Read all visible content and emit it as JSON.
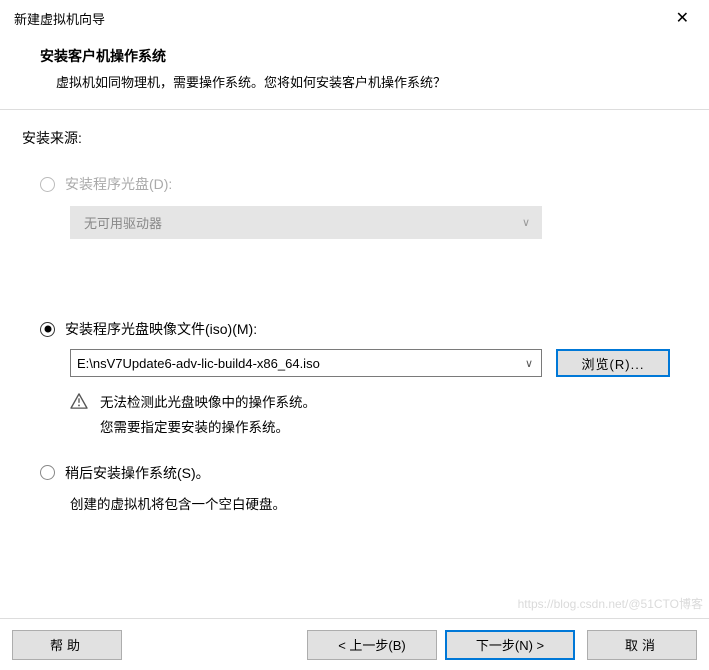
{
  "titlebar": {
    "title": "新建虚拟机向导",
    "close": "✕"
  },
  "header": {
    "title": "安装客户机操作系统",
    "desc": "虚拟机如同物理机，需要操作系统。您将如何安装客户机操作系统？"
  },
  "body": {
    "source_label": "安装来源:",
    "opt_disc": {
      "label": "安装程序光盘(D):",
      "dropdown": "无可用驱动器",
      "chevron": "∨"
    },
    "opt_iso": {
      "label": "安装程序光盘映像文件(iso)(M):",
      "value": "E:\\nsV7Update6-adv-lic-build4-x86_64.iso",
      "chevron": "∨",
      "browse": "浏览(R)...",
      "warn_line1": "无法检测此光盘映像中的操作系统。",
      "warn_line2": "您需要指定要安装的操作系统。"
    },
    "opt_later": {
      "label": "稍后安装操作系统(S)。",
      "desc": "创建的虚拟机将包含一个空白硬盘。"
    }
  },
  "footer": {
    "help": "帮助",
    "back": "< 上一步(B)",
    "next": "下一步(N) >",
    "cancel": "取消"
  },
  "watermark": "https://blog.csdn.net/@51CTO博客"
}
